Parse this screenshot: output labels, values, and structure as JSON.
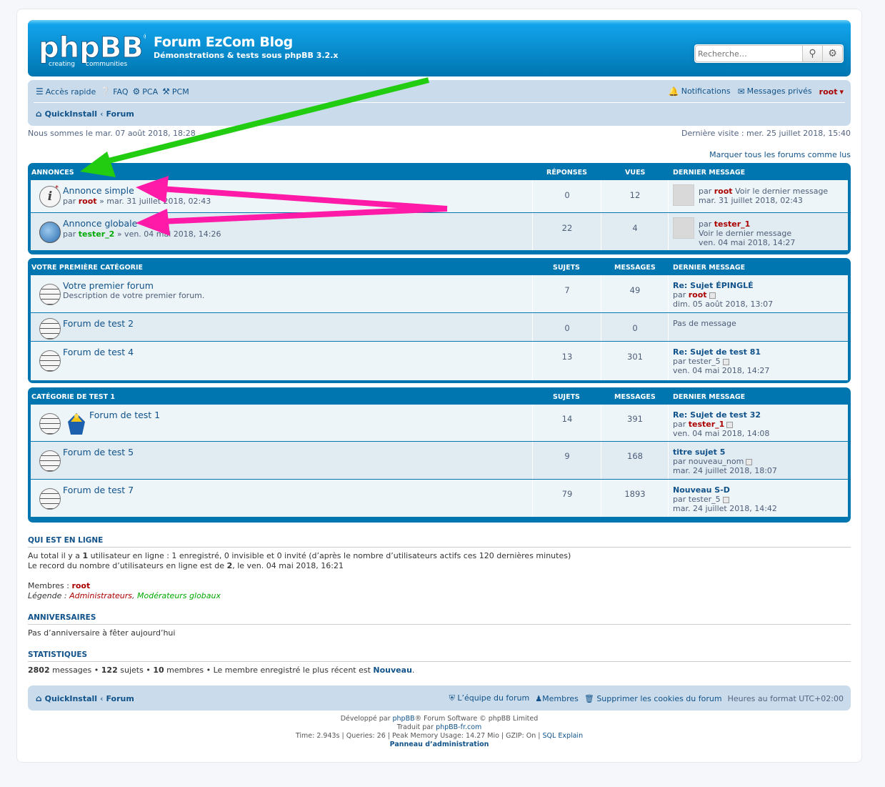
{
  "site": {
    "title": "Forum EzCom Blog",
    "description": "Démonstrations & tests sous phpBB 3.2.x",
    "logo_text": "phpBB",
    "logo_sub1": "creating",
    "logo_sub2": "communities"
  },
  "search": {
    "placeholder": "Recherche…"
  },
  "nav": {
    "quick": "Accès rapide",
    "faq": "FAQ",
    "pca": "PCA",
    "pcm": "PCM",
    "notifications": "Notifications",
    "pm": "Messages privés",
    "user": "root",
    "crumb_home": "QuickInstall",
    "crumb_forum": "Forum"
  },
  "times": {
    "now": "Nous sommes le mar. 07 août 2018, 18:28",
    "last": "Dernière visite : mer. 25 juillet 2018, 15:40",
    "markall": "Marquer tous les forums comme lus"
  },
  "announcements": {
    "header": "Annonces",
    "col2": "Réponses",
    "col3": "Vues",
    "col4": "Dernier message",
    "rows": [
      {
        "title": "Annonce simple",
        "by": "par",
        "author": "root",
        "date": "» mar. 31 juillet 2018, 02:43",
        "replies": "0",
        "views": "12",
        "lp_by": "par",
        "lp_author": "root",
        "lp_view": "Voir le dernier message",
        "lp_date": "mar. 31 juillet 2018, 02:43"
      },
      {
        "title": "Annonce globale",
        "by": "par",
        "author": "tester_2",
        "date": "» ven. 04 mai 2018, 14:26",
        "replies": "22",
        "views": "4",
        "lp_by": "par",
        "lp_author": "tester_1",
        "lp_view": "Voir le dernier message",
        "lp_date": "ven. 04 mai 2018, 14:27"
      }
    ]
  },
  "cat1": {
    "header": "Votre première catégorie",
    "col2": "Sujets",
    "col3": "Messages",
    "col4": "Dernier message",
    "rows": [
      {
        "title": "Votre premier forum",
        "desc": "Description de votre premier forum.",
        "topics": "7",
        "posts": "49",
        "lp_title": "Re: Sujet ÉPINGLÉ",
        "lp_by": "par",
        "lp_author": "root",
        "lp_date": "dim. 05 août 2018, 13:07"
      },
      {
        "title": "Forum de test 2",
        "topics": "0",
        "posts": "0",
        "lp_none": "Pas de message"
      },
      {
        "title": "Forum de test 4",
        "topics": "13",
        "posts": "301",
        "lp_title": "Re: Sujet de test 81",
        "lp_by": "par",
        "lp_author": "tester_5",
        "lp_date": "ven. 04 mai 2018, 14:27"
      }
    ]
  },
  "cat2": {
    "header": "Catégorie de test 1",
    "col2": "Sujets",
    "col3": "Messages",
    "col4": "Dernier message",
    "rows": [
      {
        "title": "Forum de test 1",
        "topics": "14",
        "posts": "391",
        "lp_title": "Re: Sujet de test 32",
        "lp_by": "par",
        "lp_author": "tester_1",
        "lp_date": "ven. 04 mai 2018, 14:08"
      },
      {
        "title": "Forum de test 5",
        "topics": "9",
        "posts": "168",
        "lp_title": "titre sujet 5",
        "lp_by": "par",
        "lp_author": "nouveau_nom",
        "lp_date": "mar. 24 juillet 2018, 18:07"
      },
      {
        "title": "Forum de test 7",
        "topics": "79",
        "posts": "1893",
        "lp_title": "Nouveau S-D",
        "lp_by": "par",
        "lp_author": "tester_5",
        "lp_date": "mar. 24 juillet 2018, 14:42"
      }
    ]
  },
  "online": {
    "header": "Qui est en ligne",
    "line1_a": "Au total il y a ",
    "line1_n": "1",
    "line1_b": " utilisateur en ligne : 1 enregistré, 0 invisible et 0 invité (d’après le nombre d’utilisateurs actifs ces 120 dernières minutes)",
    "line2_a": "Le record du nombre d’utilisateurs en ligne est de ",
    "line2_n": "2",
    "line2_b": ", le ven. 04 mai 2018, 16:21",
    "members_label": "Membres : ",
    "members_user": "root",
    "legend_label": "Légende : ",
    "legend_admin": "Administrateurs",
    "legend_sep": ", ",
    "legend_mod": "Modérateurs globaux"
  },
  "birthdays": {
    "header": "Anniversaires",
    "text": "Pas d’anniversaire à fêter aujourd’hui"
  },
  "stats": {
    "header": "Statistiques",
    "posts_n": "2802",
    "posts_l": " messages • ",
    "topics_n": "122",
    "topics_l": " sujets • ",
    "members_n": "10",
    "members_l": " membres • Le membre enregistré le plus récent est ",
    "newest": "Nouveau",
    "end": "."
  },
  "footer": {
    "crumb_home": "QuickInstall",
    "crumb_forum": "Forum",
    "team": "L’équipe du forum",
    "members": "Membres",
    "cookies": "Supprimer les cookies du forum",
    "tz": "Heures au format UTC+02:00",
    "dev_a": "Développé par ",
    "dev_link": "phpBB",
    "dev_b": "® Forum Software © phpBB Limited",
    "trans_a": "Traduit par ",
    "trans_link": "phpBB-fr.com",
    "perf": "Time: 2.943s | Queries: 26 | Peak Memory Usage: 14.27 Mio | GZIP: On | ",
    "sql": "SQL Explain",
    "acp": "Panneau d’administration"
  },
  "colors": {
    "header_blue": "#0076b1",
    "nav_bg": "#cadceb",
    "arrow_green": "#22cc11",
    "arrow_pink": "#ff1aa8",
    "admin_red": "#aa0000",
    "mod_green": "#00aa00"
  }
}
